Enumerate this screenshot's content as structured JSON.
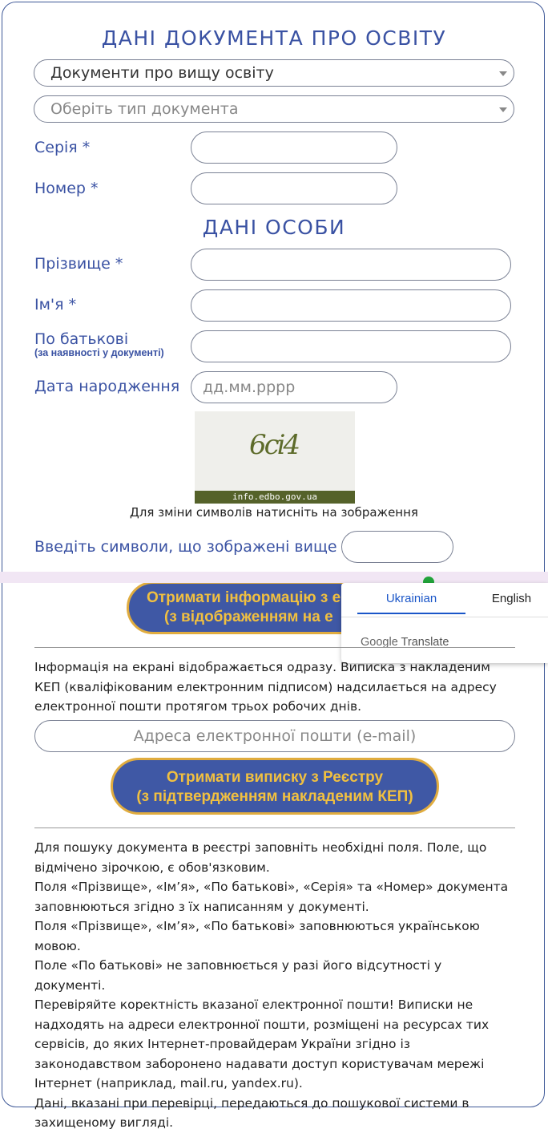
{
  "doc": {
    "title": "ДАНІ ДОКУМЕНТА ПРО ОСВІТУ",
    "category_select": "Документи про вищу освіту",
    "type_select_placeholder": "Оберіть тип документа",
    "series_label": "Серія *",
    "number_label": "Номер *"
  },
  "person": {
    "title": "ДАНІ ОСОБИ",
    "surname_label": "Прізвище *",
    "name_label": "Ім'я *",
    "patronymic_label": "По батькові",
    "patronymic_note": "(за наявності у документі)",
    "dob_label": "Дата народження",
    "dob_placeholder": "дд.мм.рррр"
  },
  "captcha": {
    "code": "6сі4",
    "site": "info.edbo.gov.ua",
    "hint": "Для зміни символів натисніть на зображення",
    "input_label": "Введіть символи, що зображені вище"
  },
  "actions": {
    "get_info_line1": "Отримати інформацію з е",
    "get_info_line2": "(з відображенням на е",
    "info_text": "Інформація на екрані відображається одразу. Виписка з накладеним КЕП (кваліфікованим електронним підписом) надсилається на адресу електронної пошти протягом трьох робочих днів.",
    "email_placeholder": "Адреса електронної пошти (e-mail)",
    "get_extract_line1": "Отримати виписку з Реєстру",
    "get_extract_line2": "(з підтвердженням накладеним КЕП)"
  },
  "notes": {
    "p1": "Для пошуку документа в реєстрі заповніть необхідні поля. Поле, що відмічено зірочкою, є обов'язковим.",
    "p2": "Поля «Прізвище», «Ім’я», «По батькові», «Серія» та «Номер» документа заповнюються згідно з їх написанням у документі.",
    "p3": "Поля «Прізвище», «Ім’я», «По батькові» заповнюються українською мовою.",
    "p4": "Поле «По батькові» не заповнюється у разі його відсутності у документі.",
    "p5": "Перевіряйте коректність вказаної електронної пошти! Виписки не надходять на адреси електронної пошти, розміщені на ресурсах тих сервісів, до яких Інтернет-провайдерам України згідно із законодавством заборонено надавати доступ користувачам мережі Інтернет (наприклад, mail.ru, yandex.ru).",
    "p6": "Дані, вказані при перевірці, передаються до пошукової системи в захищеному вигляді."
  },
  "translate": {
    "lang_active": "Ukrainian",
    "lang_other": "English",
    "brand_google": "Google",
    "brand_translate": "Translate"
  },
  "colors": {
    "accent": "#3a52a3",
    "button_bg": "#3f58a5",
    "button_text": "#f1c040",
    "button_border": "#e0ac3f"
  }
}
